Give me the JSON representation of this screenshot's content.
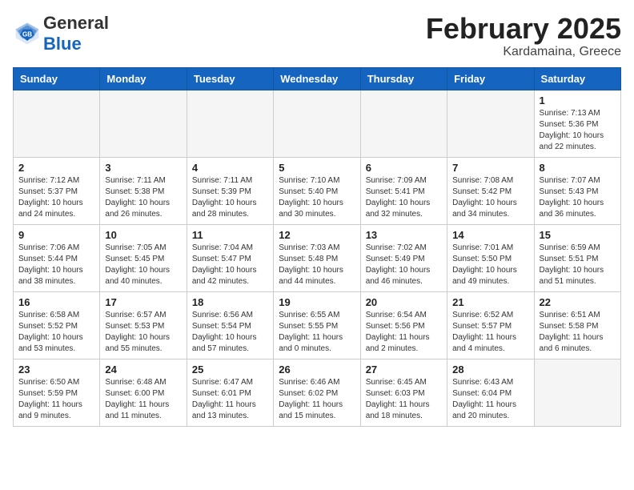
{
  "header": {
    "logo_general": "General",
    "logo_blue": "Blue",
    "month_title": "February 2025",
    "location": "Kardamaina, Greece"
  },
  "calendar": {
    "days_of_week": [
      "Sunday",
      "Monday",
      "Tuesday",
      "Wednesday",
      "Thursday",
      "Friday",
      "Saturday"
    ],
    "weeks": [
      [
        {
          "day": "",
          "info": ""
        },
        {
          "day": "",
          "info": ""
        },
        {
          "day": "",
          "info": ""
        },
        {
          "day": "",
          "info": ""
        },
        {
          "day": "",
          "info": ""
        },
        {
          "day": "",
          "info": ""
        },
        {
          "day": "1",
          "info": "Sunrise: 7:13 AM\nSunset: 5:36 PM\nDaylight: 10 hours\nand 22 minutes."
        }
      ],
      [
        {
          "day": "2",
          "info": "Sunrise: 7:12 AM\nSunset: 5:37 PM\nDaylight: 10 hours\nand 24 minutes."
        },
        {
          "day": "3",
          "info": "Sunrise: 7:11 AM\nSunset: 5:38 PM\nDaylight: 10 hours\nand 26 minutes."
        },
        {
          "day": "4",
          "info": "Sunrise: 7:11 AM\nSunset: 5:39 PM\nDaylight: 10 hours\nand 28 minutes."
        },
        {
          "day": "5",
          "info": "Sunrise: 7:10 AM\nSunset: 5:40 PM\nDaylight: 10 hours\nand 30 minutes."
        },
        {
          "day": "6",
          "info": "Sunrise: 7:09 AM\nSunset: 5:41 PM\nDaylight: 10 hours\nand 32 minutes."
        },
        {
          "day": "7",
          "info": "Sunrise: 7:08 AM\nSunset: 5:42 PM\nDaylight: 10 hours\nand 34 minutes."
        },
        {
          "day": "8",
          "info": "Sunrise: 7:07 AM\nSunset: 5:43 PM\nDaylight: 10 hours\nand 36 minutes."
        }
      ],
      [
        {
          "day": "9",
          "info": "Sunrise: 7:06 AM\nSunset: 5:44 PM\nDaylight: 10 hours\nand 38 minutes."
        },
        {
          "day": "10",
          "info": "Sunrise: 7:05 AM\nSunset: 5:45 PM\nDaylight: 10 hours\nand 40 minutes."
        },
        {
          "day": "11",
          "info": "Sunrise: 7:04 AM\nSunset: 5:47 PM\nDaylight: 10 hours\nand 42 minutes."
        },
        {
          "day": "12",
          "info": "Sunrise: 7:03 AM\nSunset: 5:48 PM\nDaylight: 10 hours\nand 44 minutes."
        },
        {
          "day": "13",
          "info": "Sunrise: 7:02 AM\nSunset: 5:49 PM\nDaylight: 10 hours\nand 46 minutes."
        },
        {
          "day": "14",
          "info": "Sunrise: 7:01 AM\nSunset: 5:50 PM\nDaylight: 10 hours\nand 49 minutes."
        },
        {
          "day": "15",
          "info": "Sunrise: 6:59 AM\nSunset: 5:51 PM\nDaylight: 10 hours\nand 51 minutes."
        }
      ],
      [
        {
          "day": "16",
          "info": "Sunrise: 6:58 AM\nSunset: 5:52 PM\nDaylight: 10 hours\nand 53 minutes."
        },
        {
          "day": "17",
          "info": "Sunrise: 6:57 AM\nSunset: 5:53 PM\nDaylight: 10 hours\nand 55 minutes."
        },
        {
          "day": "18",
          "info": "Sunrise: 6:56 AM\nSunset: 5:54 PM\nDaylight: 10 hours\nand 57 minutes."
        },
        {
          "day": "19",
          "info": "Sunrise: 6:55 AM\nSunset: 5:55 PM\nDaylight: 11 hours\nand 0 minutes."
        },
        {
          "day": "20",
          "info": "Sunrise: 6:54 AM\nSunset: 5:56 PM\nDaylight: 11 hours\nand 2 minutes."
        },
        {
          "day": "21",
          "info": "Sunrise: 6:52 AM\nSunset: 5:57 PM\nDaylight: 11 hours\nand 4 minutes."
        },
        {
          "day": "22",
          "info": "Sunrise: 6:51 AM\nSunset: 5:58 PM\nDaylight: 11 hours\nand 6 minutes."
        }
      ],
      [
        {
          "day": "23",
          "info": "Sunrise: 6:50 AM\nSunset: 5:59 PM\nDaylight: 11 hours\nand 9 minutes."
        },
        {
          "day": "24",
          "info": "Sunrise: 6:48 AM\nSunset: 6:00 PM\nDaylight: 11 hours\nand 11 minutes."
        },
        {
          "day": "25",
          "info": "Sunrise: 6:47 AM\nSunset: 6:01 PM\nDaylight: 11 hours\nand 13 minutes."
        },
        {
          "day": "26",
          "info": "Sunrise: 6:46 AM\nSunset: 6:02 PM\nDaylight: 11 hours\nand 15 minutes."
        },
        {
          "day": "27",
          "info": "Sunrise: 6:45 AM\nSunset: 6:03 PM\nDaylight: 11 hours\nand 18 minutes."
        },
        {
          "day": "28",
          "info": "Sunrise: 6:43 AM\nSunset: 6:04 PM\nDaylight: 11 hours\nand 20 minutes."
        },
        {
          "day": "",
          "info": ""
        }
      ]
    ]
  }
}
